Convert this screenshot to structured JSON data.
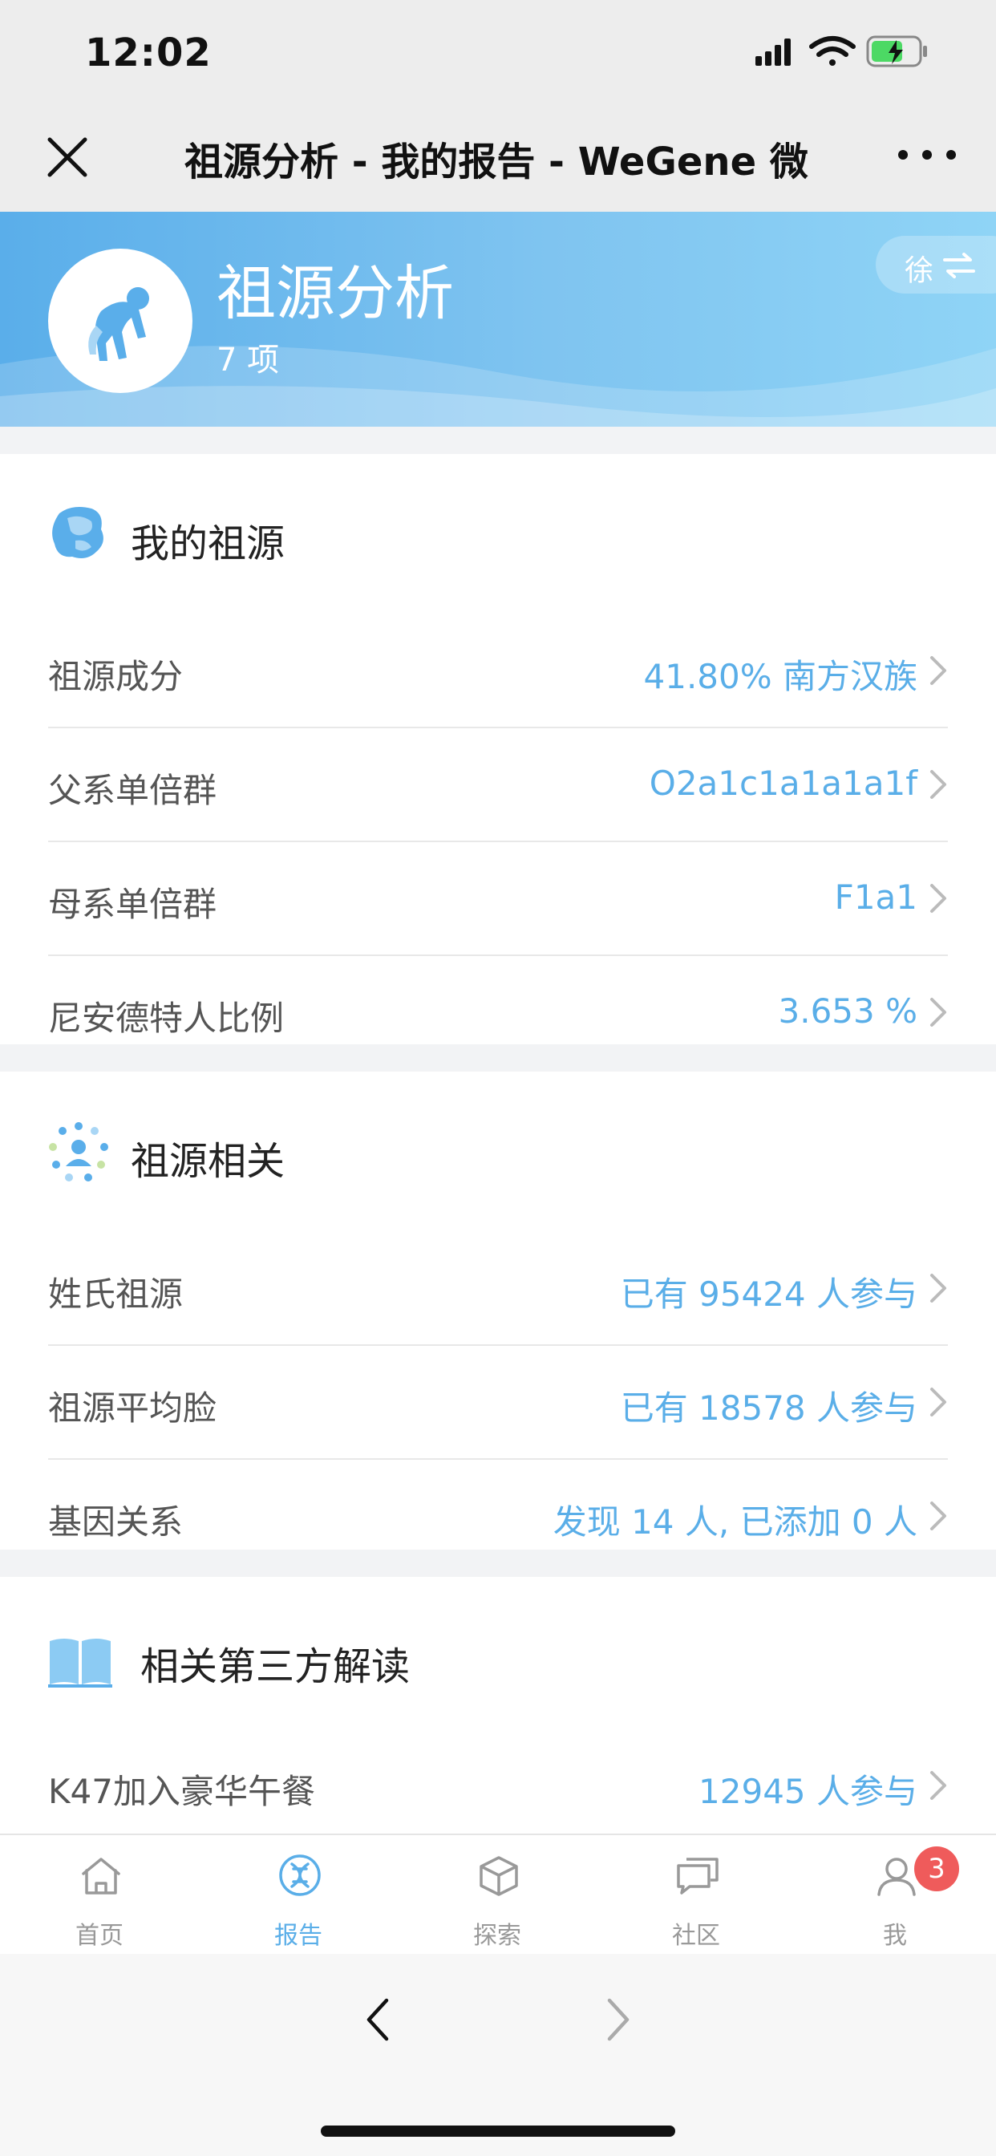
{
  "status_bar": {
    "time": "12:02"
  },
  "nav": {
    "title": "祖源分析 - 我的报告 - WeGene 微"
  },
  "banner": {
    "title": "祖源分析",
    "count": "7 项",
    "user_initial": "徐",
    "avatar_icon": "ape-icon",
    "colors": {
      "start": "#5aaeea",
      "end": "#8fd4f6"
    }
  },
  "sections": {
    "my_ancestry": {
      "title": "我的祖源",
      "icon": "map-icon",
      "rows": [
        {
          "label": "祖源成分",
          "value": "41.80% 南方汉族"
        },
        {
          "label": "父系单倍群",
          "value": "O2a1c1a1a1a1f"
        },
        {
          "label": "母系单倍群",
          "value": "F1a1"
        },
        {
          "label": "尼安德特人比例",
          "value": "3.653 %"
        }
      ]
    },
    "related": {
      "title": "祖源相关",
      "icon": "people-network-icon",
      "rows": [
        {
          "label": "姓氏祖源",
          "value": "已有 95424 人参与"
        },
        {
          "label": "祖源平均脸",
          "value": "已有 18578 人参与"
        },
        {
          "label": "基因关系",
          "value": "发现 14 人, 已添加 0 人"
        }
      ]
    },
    "third_party": {
      "title": "相关第三方解读",
      "icon": "book-icon",
      "rows": [
        {
          "label": "K47加入豪华午餐",
          "value": "12945 人参与"
        }
      ]
    }
  },
  "tabbar": {
    "items": [
      {
        "label": "首页",
        "icon": "home-icon"
      },
      {
        "label": "报告",
        "icon": "dna-icon"
      },
      {
        "label": "探索",
        "icon": "cube-icon"
      },
      {
        "label": "社区",
        "icon": "chat-icon"
      },
      {
        "label": "我",
        "icon": "user-icon"
      }
    ],
    "active_index": 1,
    "badge": "3"
  },
  "colors": {
    "accent": "#5aaee8",
    "badge": "#ef5b5b"
  }
}
